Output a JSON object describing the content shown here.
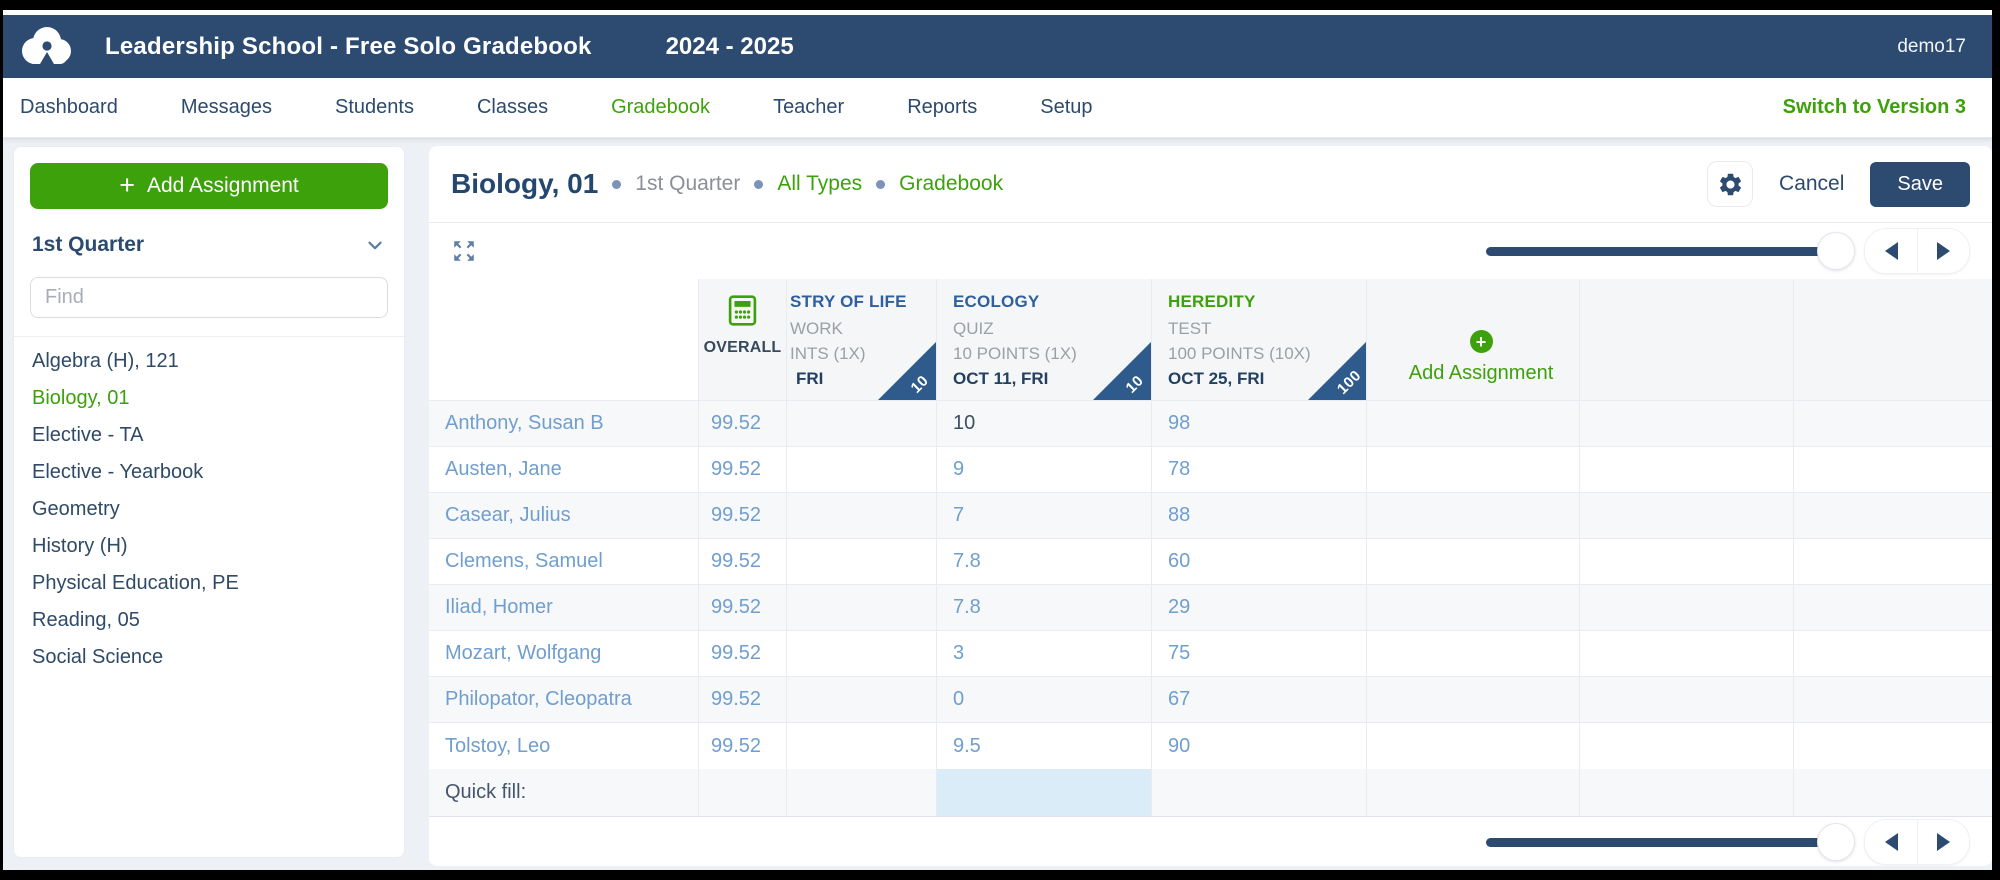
{
  "colors": {
    "accent_green": "#3da10b",
    "navy": "#2d4b70",
    "corner_badge_blue": "#2e5b8b",
    "column_title_blue": "#2f5f9e",
    "link_blue": "#6f9ecf",
    "quick_fill_highlight": "#d9ecf8"
  },
  "icons": [
    "cloud-logo",
    "calculator-icon",
    "plus-circle-icon",
    "gear-icon",
    "expand-icon",
    "chevron-down-icon",
    "prev-arrow-icon",
    "next-arrow-icon"
  ],
  "topbar": {
    "school_title": "Leadership School - Free Solo Gradebook",
    "school_year": "2024 - 2025",
    "username": "demo17"
  },
  "nav": {
    "items": [
      {
        "label": "Dashboard",
        "active": false
      },
      {
        "label": "Messages",
        "active": false
      },
      {
        "label": "Students",
        "active": false
      },
      {
        "label": "Classes",
        "active": false
      },
      {
        "label": "Gradebook",
        "active": true
      },
      {
        "label": "Teacher",
        "active": false
      },
      {
        "label": "Reports",
        "active": false
      },
      {
        "label": "Setup",
        "active": false
      }
    ],
    "switch_version": "Switch to Version 3"
  },
  "sidebar": {
    "add_assignment": "Add Assignment",
    "plus_glyph": "+",
    "quarter": "1st Quarter",
    "find_placeholder": "Find",
    "classes": [
      {
        "label": "Algebra (H), 121",
        "active": false
      },
      {
        "label": "Biology, 01",
        "active": true
      },
      {
        "label": "Elective - TA",
        "active": false
      },
      {
        "label": "Elective - Yearbook",
        "active": false
      },
      {
        "label": "Geometry",
        "active": false
      },
      {
        "label": "History (H)",
        "active": false
      },
      {
        "label": "Physical Education, PE",
        "active": false
      },
      {
        "label": "Reading, 05",
        "active": false
      },
      {
        "label": "Social Science",
        "active": false
      }
    ]
  },
  "main": {
    "title": "Biology, 01",
    "breadcrumbs": {
      "quarter": "1st Quarter",
      "types": "All Types",
      "view": "Gradebook"
    },
    "cancel": "Cancel",
    "save": "Save",
    "table": {
      "overall_label": "OVERALL",
      "add_assignment": "Add Assignment",
      "plus_glyph": "+",
      "quick_fill": "Quick fill:",
      "assignments": [
        {
          "title": "STRY OF LIFE",
          "type": "WORK",
          "points": "INTS (1X)",
          "date": "FRI",
          "max": "10",
          "truncated": true,
          "title_green": false
        },
        {
          "title": "ECOLOGY",
          "type": "QUIZ",
          "points": "10 POINTS (1X)",
          "date": "OCT 11, FRI",
          "max": "10",
          "truncated": false,
          "title_green": false
        },
        {
          "title": "HEREDITY",
          "type": "TEST",
          "points": "100 POINTS (10X)",
          "date": "OCT 25, FRI",
          "max": "100",
          "truncated": false,
          "title_green": true
        }
      ],
      "rows": [
        {
          "name": "Anthony, Susan B",
          "overall": "99.52",
          "a0": "",
          "a1": "10",
          "a2": "98",
          "a1_edited": true
        },
        {
          "name": "Austen, Jane",
          "overall": "99.52",
          "a0": "",
          "a1": "9",
          "a2": "78",
          "a1_edited": false
        },
        {
          "name": "Casear, Julius",
          "overall": "99.52",
          "a0": "",
          "a1": "7",
          "a2": "88",
          "a1_edited": false
        },
        {
          "name": "Clemens, Samuel",
          "overall": "99.52",
          "a0": "",
          "a1": "7.8",
          "a2": "60",
          "a1_edited": false
        },
        {
          "name": "Iliad, Homer",
          "overall": "99.52",
          "a0": "",
          "a1": "7.8",
          "a2": "29",
          "a1_edited": false
        },
        {
          "name": "Mozart, Wolfgang",
          "overall": "99.52",
          "a0": "",
          "a1": "3",
          "a2": "75",
          "a1_edited": false
        },
        {
          "name": "Philopator, Cleopatra",
          "overall": "99.52",
          "a0": "",
          "a1": "0",
          "a2": "67",
          "a1_edited": false
        },
        {
          "name": "Tolstoy, Leo",
          "overall": "99.52",
          "a0": "",
          "a1": "9.5",
          "a2": "90",
          "a1_edited": false
        }
      ]
    }
  }
}
